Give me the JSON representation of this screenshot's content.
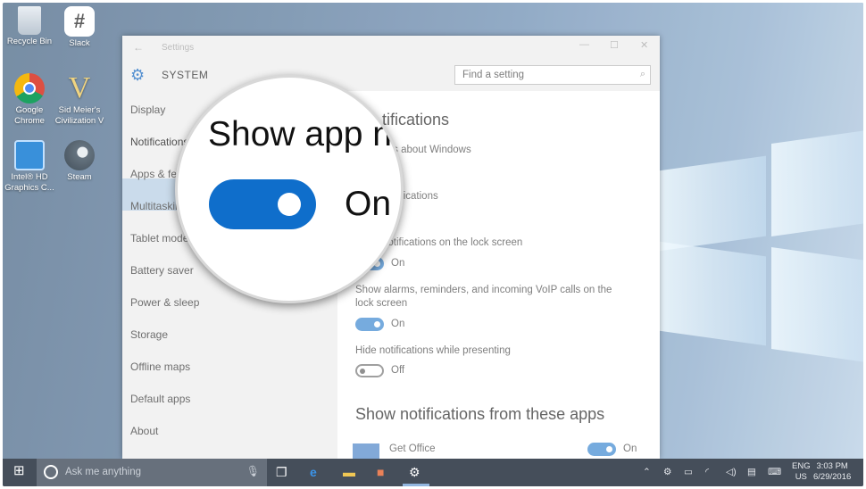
{
  "desktop": {
    "icons": [
      {
        "label": "Recycle Bin"
      },
      {
        "label": "Slack"
      },
      {
        "label": "Google Chrome"
      },
      {
        "label": "Sid Meier's Civilization V"
      },
      {
        "label": "Intel® HD Graphics C..."
      },
      {
        "label": "Steam"
      }
    ]
  },
  "window": {
    "back_icon": "back-arrow-icon",
    "title": "Settings",
    "minimize": "minimize-icon",
    "maximize": "maximize-icon",
    "close": "close-icon"
  },
  "header": {
    "section": "SYSTEM",
    "search_placeholder": "Find a setting"
  },
  "nav": {
    "items": [
      {
        "label": "Display"
      },
      {
        "label": "Notifications",
        "selected": true
      },
      {
        "label": "Apps & fe"
      },
      {
        "label": "Multitaskin"
      },
      {
        "label": "Tablet mode"
      },
      {
        "label": "Battery saver"
      },
      {
        "label": "Power & sleep"
      },
      {
        "label": "Storage"
      },
      {
        "label": "Offline maps"
      },
      {
        "label": "Default apps"
      },
      {
        "label": "About"
      }
    ]
  },
  "content": {
    "heading": "tifications",
    "settings": [
      {
        "label": "tips about Windows",
        "state": "n",
        "toggle": "on"
      },
      {
        "label": "notifications",
        "state": "n",
        "toggle": "on"
      },
      {
        "label": "notifications on the lock screen",
        "state": "On",
        "toggle": "on"
      },
      {
        "label": "Show alarms, reminders, and incoming VoIP calls on the lock screen",
        "state": "On",
        "toggle": "on"
      },
      {
        "label": "Hide notifications while presenting",
        "state": "Off",
        "toggle": "off"
      }
    ],
    "apps_heading": "Show notifications from these apps",
    "apps": [
      {
        "name": "Get Office",
        "state": "On",
        "toggle": "on"
      }
    ]
  },
  "magnifier": {
    "text": "Show app n",
    "state": "On",
    "toggle": "on"
  },
  "taskbar": {
    "search_hint": "Ask me anything",
    "lang_top": "ENG",
    "lang_bottom": "US",
    "time": "3:03 PM",
    "date": "6/29/2016"
  },
  "colors": {
    "accent": "#0f6ecb",
    "toggle_on_dim": "#6ea6dc",
    "nav_selected": "#c7d9ea",
    "taskbar": "#3a4350"
  }
}
